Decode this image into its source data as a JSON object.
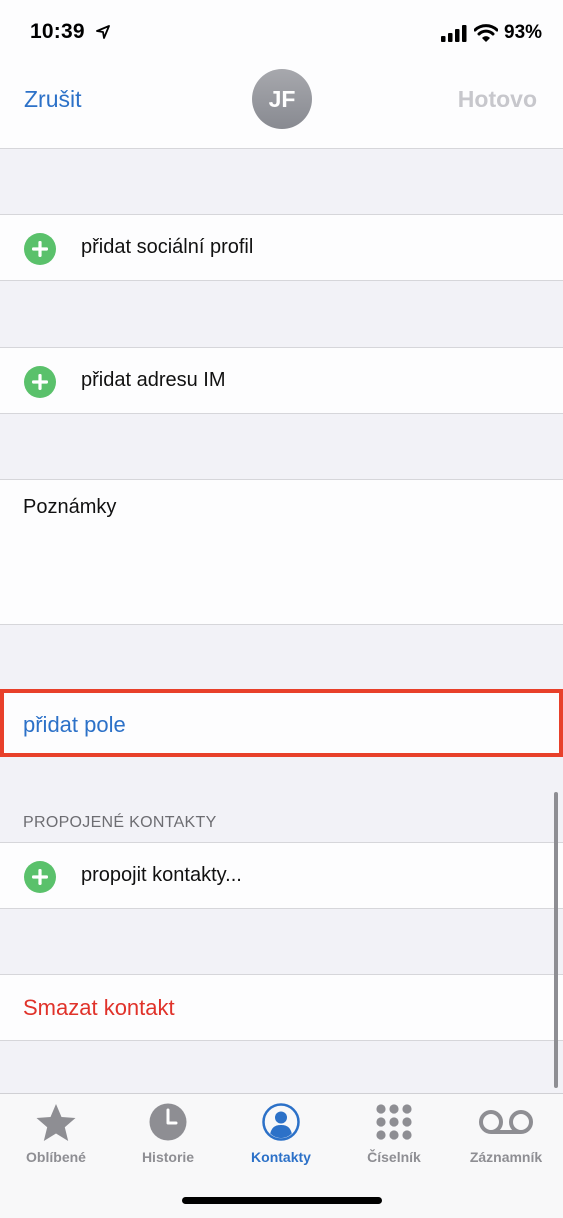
{
  "status": {
    "time": "10:39",
    "battery": "93%"
  },
  "nav": {
    "cancel": "Zrušit",
    "avatar_initials": "JF",
    "done": "Hotovo"
  },
  "rows": {
    "social": "přidat sociální profil",
    "im": "přidat adresu IM",
    "notes": "Poznámky",
    "add_field": "přidat pole",
    "linked_header": "PROPOJENÉ KONTAKTY",
    "link": "propojit kontakty...",
    "delete": "Smazat kontakt"
  },
  "tabs": [
    {
      "label": "Oblíbené",
      "icon": "star-icon"
    },
    {
      "label": "Historie",
      "icon": "clock-icon"
    },
    {
      "label": "Kontakty",
      "icon": "person-icon",
      "active": true
    },
    {
      "label": "Číselník",
      "icon": "keypad-icon"
    },
    {
      "label": "Záznamník",
      "icon": "voicemail-icon"
    }
  ],
  "colors": {
    "accent": "#2c71c8",
    "destructive": "#e0322a",
    "add": "#5ac16b",
    "highlight_box": "#e8402a"
  }
}
